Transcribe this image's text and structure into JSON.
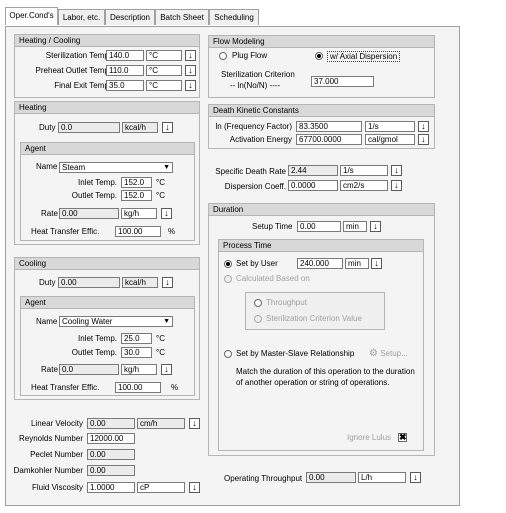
{
  "tabs": [
    "Oper.Cond's",
    "Labor, etc.",
    "Description",
    "Batch Sheet",
    "Scheduling"
  ],
  "heating_cooling": {
    "title": "Heating / Cooling",
    "ster_temp_label": "Sterilization Temp.",
    "ster_temp": "140.0",
    "ster_temp_unit": "°C",
    "preheat_label": "Preheat Outlet Temp.",
    "preheat": "110.0",
    "preheat_unit": "°C",
    "final_exit_label": "Final Exit Temp.",
    "final_exit": "35.0",
    "final_exit_unit": "°C"
  },
  "heating": {
    "title": "Heating",
    "duty_label": "Duty",
    "duty": "0.0",
    "duty_unit": "kcal/h",
    "agent": {
      "title": "Agent",
      "name_label": "Name",
      "name": "Steam",
      "inlet_label": "Inlet Temp.",
      "inlet": "152.0",
      "inlet_unit": "°C",
      "outlet_label": "Outlet Temp.",
      "outlet": "152.0",
      "outlet_unit": "°C",
      "rate_label": "Rate",
      "rate": "0.00",
      "rate_unit": "kg/h",
      "eff_label": "Heat Transfer Effic.",
      "eff": "100.00",
      "eff_unit": "%"
    }
  },
  "cooling": {
    "title": "Cooling",
    "duty_label": "Duty",
    "duty": "0.00",
    "duty_unit": "kcal/h",
    "agent": {
      "title": "Agent",
      "name_label": "Name",
      "name": "Cooling Water",
      "inlet_label": "Inlet Temp.",
      "inlet": "25.0",
      "inlet_unit": "°C",
      "outlet_label": "Outlet Temp.",
      "outlet": "30.0",
      "outlet_unit": "°C",
      "rate_label": "Rate",
      "rate": "0.0",
      "rate_unit": "kg/h",
      "eff_label": "Heat Transfer Effic.",
      "eff": "100.00",
      "eff_unit": "%"
    }
  },
  "bottom_left": {
    "lin_vel_label": "Linear Velocity",
    "lin_vel": "0.00",
    "lin_vel_unit": "cm/h",
    "reynolds_label": "Reynolds Number",
    "reynolds": "12000.00",
    "peclet_label": "Peclet Number",
    "peclet": "0.00",
    "damkohler_label": "Damkohler Number",
    "damkohler": "0.00",
    "viscosity_label": "Fluid Viscosity",
    "viscosity": "1.0000",
    "viscosity_unit": "cP"
  },
  "flow_modeling": {
    "title": "Flow Modeling",
    "plug_label": "Plug Flow",
    "axial_label": "w/ Axial Dispersion",
    "crit_label1": "Sterilization Criterion",
    "crit_label2": "-- ln(No/N) ----",
    "crit": "37.000"
  },
  "death_kinetic": {
    "title": "Death Kinetic Constants",
    "freq_label": "ln (Frequency Factor)",
    "freq": "83.3500",
    "freq_unit": "1/s",
    "act_label": "Activation Energy",
    "act": "67700.0000",
    "act_unit": "cal/gmol"
  },
  "specific_death_label": "Specific Death Rate",
  "specific_death": "2.44",
  "specific_death_unit": "1/s",
  "dispersion_label": "Dispersion Coeff.",
  "dispersion": "0.0000",
  "dispersion_unit": "cm2/s",
  "duration": {
    "title": "Duration",
    "setup_label": "Setup Time",
    "setup": "0.00",
    "setup_unit": "min",
    "process_time": {
      "title": "Process Time",
      "set_by_user_label": "Set by User",
      "set_by_user": "240.000",
      "set_by_user_unit": "min",
      "calc_label": "Calculated Based on",
      "throughput_label": "Throughput",
      "crit_label": "Sterilization Criterion Value"
    },
    "master_slave_label": "Set by Master-Slave Relationship",
    "setup_btn": "Setup...",
    "match_text": "Match the duration of this operation to the duration of another operation or string of operations.",
    "ignore_label": "Ignore Lulus"
  },
  "throughput_label": "Operating Throughput",
  "throughput": "0.00",
  "throughput_unit": "L/h"
}
